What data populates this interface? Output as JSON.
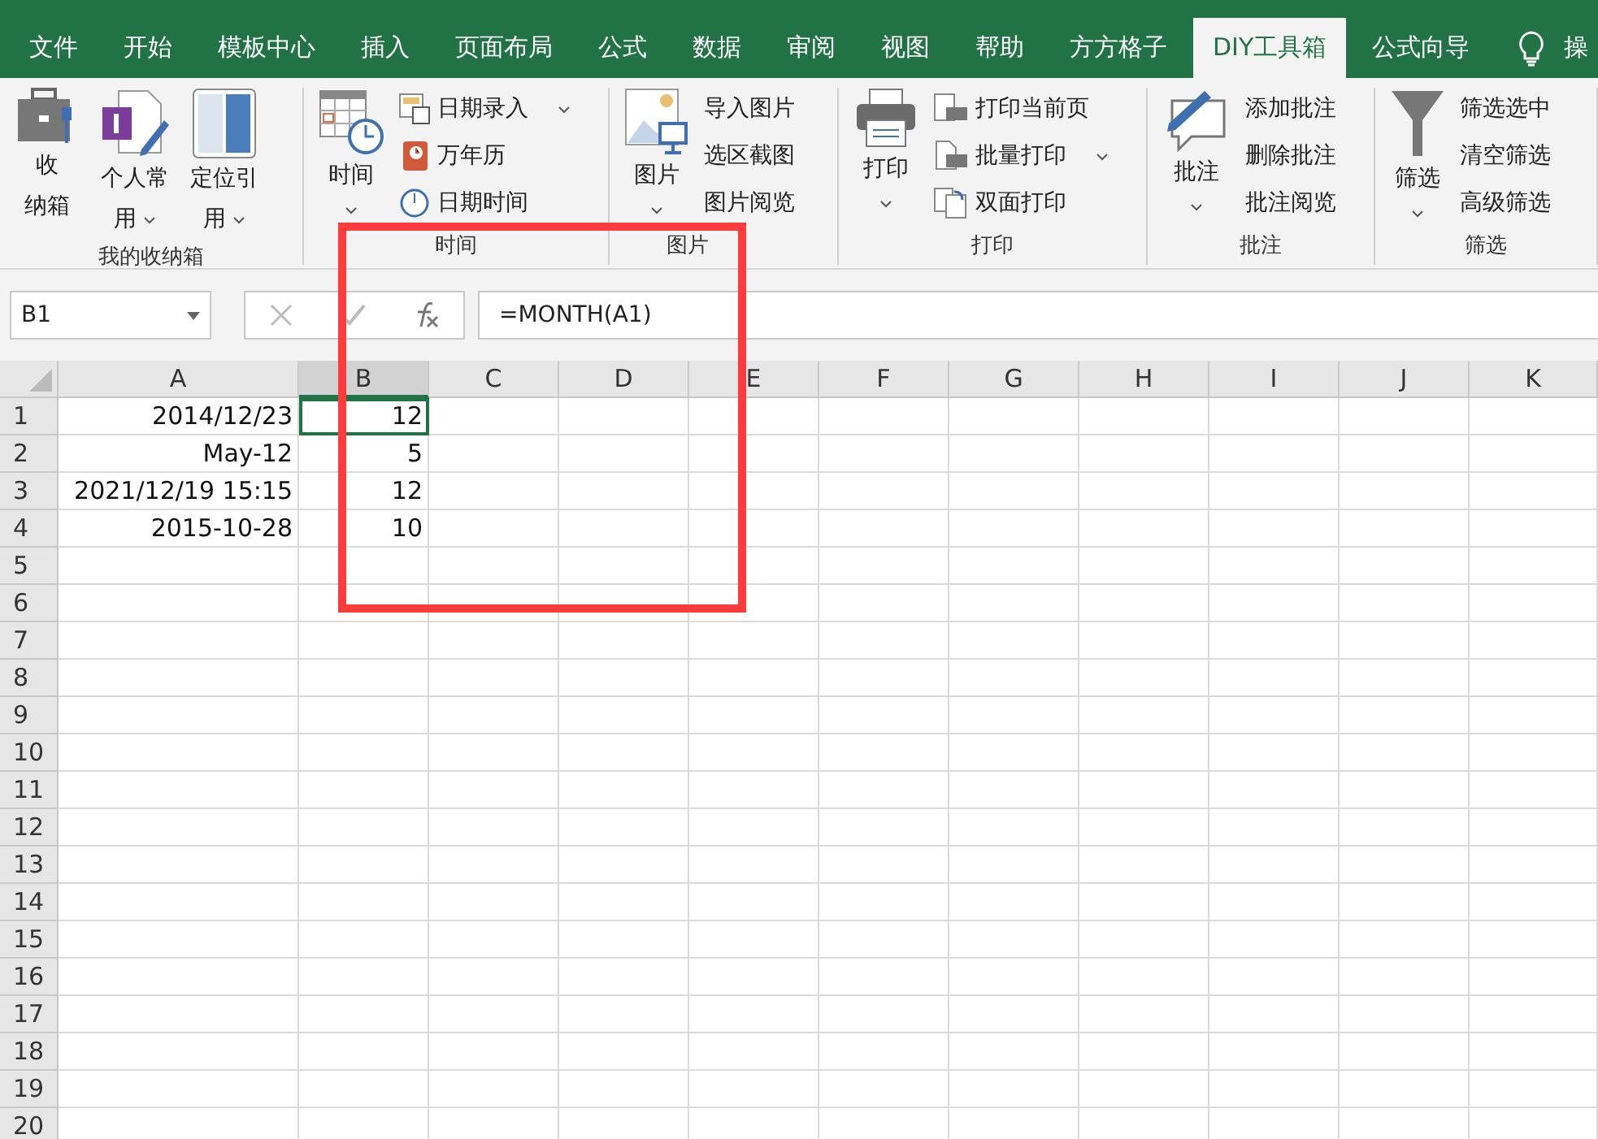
{
  "tabs": [
    {
      "label": "文件",
      "selected": false
    },
    {
      "label": "开始",
      "selected": false
    },
    {
      "label": "模板中心",
      "selected": false
    },
    {
      "label": "插入",
      "selected": false
    },
    {
      "label": "页面布局",
      "selected": false
    },
    {
      "label": "公式",
      "selected": false
    },
    {
      "label": "数据",
      "selected": false
    },
    {
      "label": "审阅",
      "selected": false
    },
    {
      "label": "视图",
      "selected": false
    },
    {
      "label": "帮助",
      "selected": false
    },
    {
      "label": "方方格子",
      "selected": false
    },
    {
      "label": "DIY工具箱",
      "selected": true
    },
    {
      "label": "公式向导",
      "selected": false
    }
  ],
  "tell_me": "操",
  "ribbon": [
    {
      "label": "我的收纳箱",
      "large": [
        {
          "lines": [
            "收",
            "纳箱"
          ],
          "dropdown": false
        },
        {
          "lines": [
            "个人常",
            "用"
          ],
          "dropdown": true
        },
        {
          "lines": [
            "定位引",
            "用"
          ],
          "dropdown": true
        }
      ]
    },
    {
      "label": "时间",
      "large": [
        {
          "lines": [
            "时间"
          ],
          "dropdown": true
        }
      ],
      "small": [
        {
          "label": "日期录入",
          "dropdown": true
        },
        {
          "label": "万年历",
          "dropdown": false
        },
        {
          "label": "日期时间",
          "dropdown": false
        }
      ]
    },
    {
      "label": "图片",
      "large": [
        {
          "lines": [
            "图片"
          ],
          "dropdown": true
        }
      ],
      "small": [
        {
          "label": "导入图片",
          "dropdown": false
        },
        {
          "label": "选区截图",
          "dropdown": false
        },
        {
          "label": "图片阅览",
          "dropdown": false
        }
      ]
    },
    {
      "label": "打印",
      "large": [
        {
          "lines": [
            "打印"
          ],
          "dropdown": true
        }
      ],
      "small": [
        {
          "label": "打印当前页",
          "dropdown": false
        },
        {
          "label": "批量打印",
          "dropdown": true
        },
        {
          "label": "双面打印",
          "dropdown": false
        }
      ]
    },
    {
      "label": "批注",
      "large": [
        {
          "lines": [
            "批注"
          ],
          "dropdown": true
        }
      ],
      "small": [
        {
          "label": "添加批注",
          "dropdown": false
        },
        {
          "label": "删除批注",
          "dropdown": false
        },
        {
          "label": "批注阅览",
          "dropdown": false
        }
      ]
    },
    {
      "label": "筛选",
      "large": [
        {
          "lines": [
            "筛选"
          ],
          "dropdown": true
        }
      ],
      "small": [
        {
          "label": "筛选选中",
          "dropdown": false
        },
        {
          "label": "清空筛选",
          "dropdown": false
        },
        {
          "label": "高级筛选",
          "dropdown": false
        }
      ]
    }
  ],
  "name_box": "B1",
  "formula": "=MONTH(A1)",
  "sheet": {
    "columns": [
      {
        "label": "A",
        "selected": false
      },
      {
        "label": "B",
        "selected": true
      },
      {
        "label": "C",
        "selected": false
      },
      {
        "label": "D",
        "selected": false
      },
      {
        "label": "E",
        "selected": false
      },
      {
        "label": "F",
        "selected": false
      },
      {
        "label": "G",
        "selected": false
      },
      {
        "label": "H",
        "selected": false
      },
      {
        "label": "I",
        "selected": false
      },
      {
        "label": "J",
        "selected": false
      },
      {
        "label": "K",
        "selected": false
      }
    ],
    "rows": [
      {
        "number": "1",
        "cells": [
          "2014/12/23",
          "12"
        ]
      },
      {
        "number": "2",
        "cells": [
          "May-12",
          "5"
        ]
      },
      {
        "number": "3",
        "cells": [
          "2021/12/19 15:15",
          "12"
        ]
      },
      {
        "number": "4",
        "cells": [
          "2015-10-28",
          "10"
        ]
      },
      {
        "number": "5",
        "cells": []
      },
      {
        "number": "6",
        "cells": []
      },
      {
        "number": "7",
        "cells": []
      },
      {
        "number": "8",
        "cells": []
      },
      {
        "number": "9",
        "cells": []
      },
      {
        "number": "10",
        "cells": []
      },
      {
        "number": "11",
        "cells": []
      },
      {
        "number": "12",
        "cells": []
      },
      {
        "number": "13",
        "cells": []
      },
      {
        "number": "14",
        "cells": []
      },
      {
        "number": "15",
        "cells": []
      },
      {
        "number": "16",
        "cells": []
      },
      {
        "number": "17",
        "cells": []
      },
      {
        "number": "18",
        "cells": []
      },
      {
        "number": "19",
        "cells": []
      },
      {
        "number": "20",
        "cells": []
      }
    ]
  },
  "annotation": {
    "kind": "highlight-box",
    "color": "#ff3b3b"
  }
}
